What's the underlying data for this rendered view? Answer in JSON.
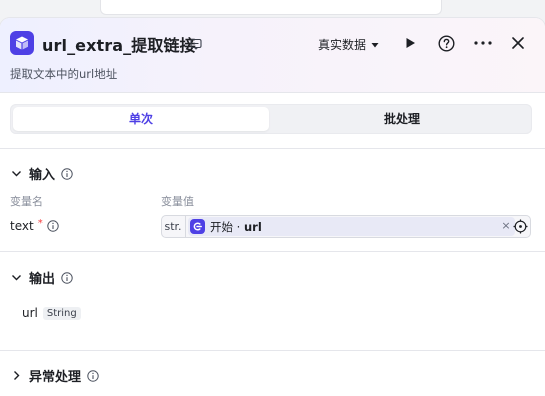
{
  "node": {
    "title": "url_extra_提取链接",
    "description": "提取文本中的url地址",
    "accent_color": "#4e40e5"
  },
  "header": {
    "mode_label": "真实数据",
    "icons": [
      "play-icon",
      "help-icon",
      "more-icon",
      "close-icon"
    ]
  },
  "tabs": [
    {
      "label": "单次",
      "active": true
    },
    {
      "label": "批处理",
      "active": false
    }
  ],
  "input_section": {
    "title": "输入",
    "col_name": "变量名",
    "col_value": "变量值",
    "params": [
      {
        "name": "text",
        "required_mark": "*",
        "type": "str.",
        "ref_node": "开始",
        "ref_separator": " · ",
        "ref_var": "url",
        "clear_glyph": "×"
      }
    ]
  },
  "output_section": {
    "title": "输出",
    "fields": [
      {
        "name": "url",
        "type": "String"
      }
    ]
  },
  "exception_section": {
    "title": "异常处理"
  }
}
